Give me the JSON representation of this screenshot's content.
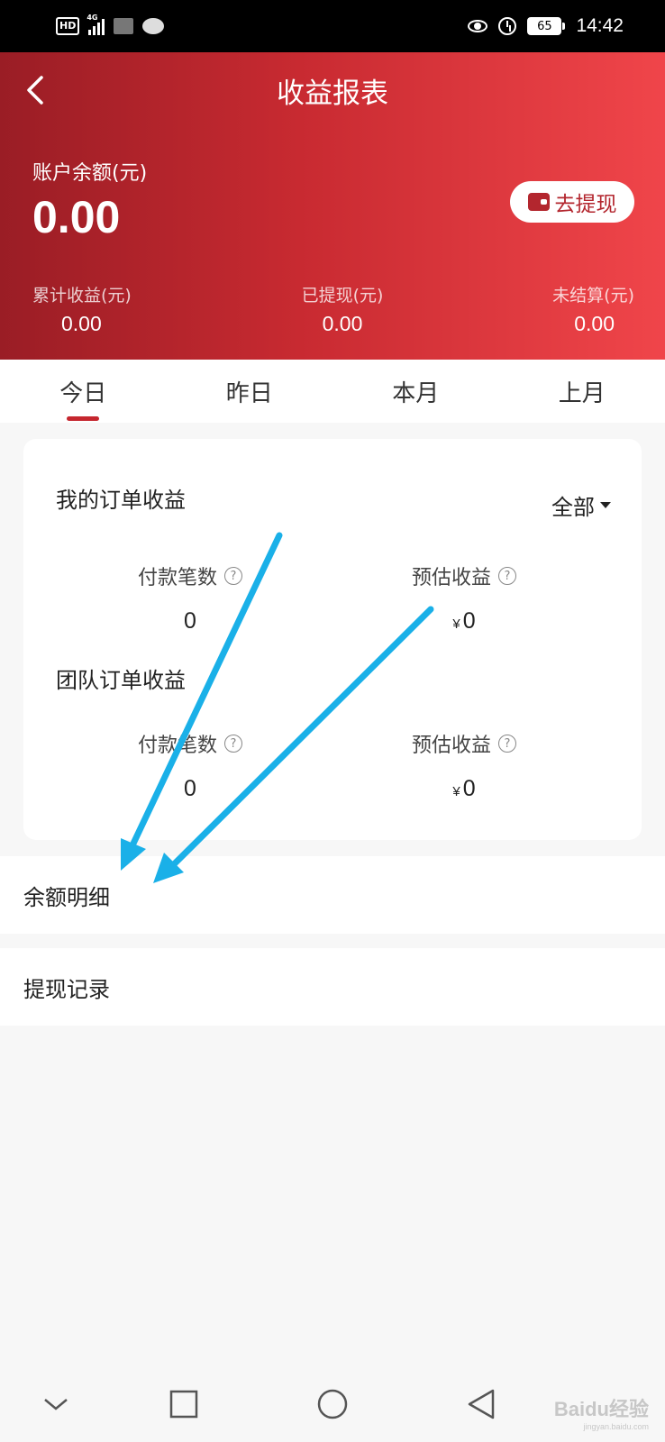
{
  "status_bar": {
    "left_icons": [
      "hd-icon",
      "signal-4g-icon",
      "blurred-app-icon",
      "chat-icon"
    ],
    "network_label": "4G",
    "hd_label": "HD",
    "right_icons": [
      "eye-icon",
      "alarm-icon",
      "battery-icon"
    ],
    "battery": "65",
    "time": "14:42"
  },
  "header": {
    "title": "收益报表",
    "back_icon": "chevron-left-icon",
    "balance_label": "账户余额(元)",
    "balance_value": "0.00",
    "withdraw_button": "去提现",
    "withdraw_icon": "wallet-icon",
    "stats": [
      {
        "label": "累计收益(元)",
        "value": "0.00"
      },
      {
        "label": "已提现(元)",
        "value": "0.00"
      },
      {
        "label": "未结算(元)",
        "value": "0.00"
      }
    ],
    "gradient_colors": [
      "#9a1d25",
      "#f0454a"
    ]
  },
  "tabs": [
    {
      "label": "今日",
      "active": true
    },
    {
      "label": "昨日",
      "active": false
    },
    {
      "label": "本月",
      "active": false
    },
    {
      "label": "上月",
      "active": false
    }
  ],
  "card": {
    "my_orders": {
      "title": "我的订单收益",
      "filter": "全部",
      "metrics": [
        {
          "label": "付款笔数",
          "value": "0",
          "currency": ""
        },
        {
          "label": "预估收益",
          "value": "0",
          "currency": "¥"
        }
      ]
    },
    "team_orders": {
      "title": "团队订单收益",
      "metrics": [
        {
          "label": "付款笔数",
          "value": "0",
          "currency": ""
        },
        {
          "label": "预估收益",
          "value": "0",
          "currency": "¥"
        }
      ]
    },
    "help_glyph": "?"
  },
  "list": [
    {
      "label": "余额明细"
    },
    {
      "label": "提现记录"
    }
  ],
  "annotation_arrow_color": "#1ab0e8",
  "nav": {
    "icons": [
      "chevron-down-icon",
      "square-icon",
      "circle-icon",
      "triangle-back-icon"
    ]
  },
  "watermark": {
    "text": "Baidu经验",
    "sub": "jingyan.baidu.com"
  },
  "accent_color": "#c5262e"
}
